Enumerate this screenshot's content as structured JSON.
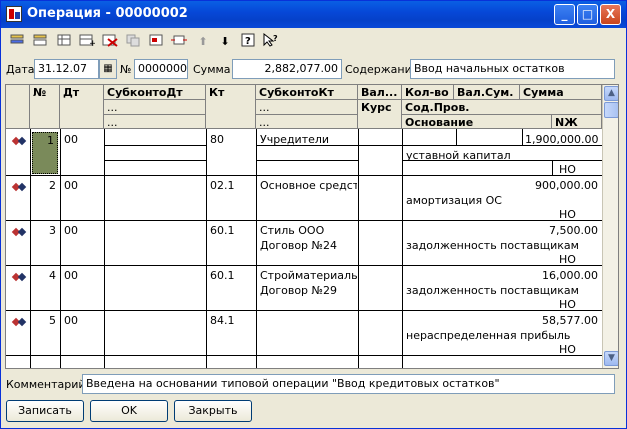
{
  "window": {
    "title": "Операция - 00000002"
  },
  "title_buttons": {
    "minimize": "_",
    "maximize": "□",
    "close": "X"
  },
  "toolbar": {
    "icons": [
      "new-row-icon",
      "copy-row-icon",
      "insert-row-icon",
      "add-sub-row-icon",
      "delete-row-icon",
      "copy-block-icon",
      "edit-row-icon",
      "filter-rows-icon",
      "move-up-icon",
      "move-down-icon",
      "help-icon",
      "whats-this-icon"
    ]
  },
  "form": {
    "date_label": "Дата",
    "date_value": "31.12.07",
    "number_label": "№",
    "number_value": "00000002",
    "sum_label": "Сумма",
    "sum_value": "2,882,077.00",
    "content_label": "Содержание",
    "content_value": "Ввод начальных остатков"
  },
  "grid": {
    "headers": {
      "num": "№",
      "dt": "Дт",
      "subkonto_dt": "СубконтоДт",
      "subkonto_dt_sub1": "...",
      "subkonto_dt_sub2": "...",
      "kt": "Кт",
      "subkonto_kt": "СубконтоКт",
      "subkonto_kt_sub1": "...",
      "subkonto_kt_sub2": "...",
      "val": "Вал...",
      "kurs": "Курс",
      "kol": "Кол-во",
      "valsum": "Вал.Сум.",
      "summa": "Сумма",
      "sod": "Сод.Пров.",
      "osnovanie": "Основание",
      "nzh": "NЖ"
    },
    "rows": [
      {
        "num": "1",
        "dt": "00",
        "kt": "80",
        "subkonto_kt": "Учредители",
        "subkonto_kt2": "",
        "summa": "1,900,000.00",
        "sod": "уставной капитал",
        "nzh": "НО"
      },
      {
        "num": "2",
        "dt": "00",
        "kt": "02.1",
        "subkonto_kt": "Основное средств",
        "subkonto_kt2": "",
        "summa": "900,000.00",
        "sod": "амортизация ОС",
        "nzh": "НО"
      },
      {
        "num": "3",
        "dt": "00",
        "kt": "60.1",
        "subkonto_kt": "Стиль ООО",
        "subkonto_kt2": "Договор №24",
        "summa": "7,500.00",
        "sod": "задолженность поставщикам",
        "nzh": "НО"
      },
      {
        "num": "4",
        "dt": "00",
        "kt": "60.1",
        "subkonto_kt": "Стройматериалы б",
        "subkonto_kt2": "Договор №29",
        "summa": "16,000.00",
        "sod": "задолженность поставщикам",
        "nzh": "НО"
      },
      {
        "num": "5",
        "dt": "00",
        "kt": "84.1",
        "subkonto_kt": "",
        "subkonto_kt2": "",
        "summa": "58,577.00",
        "sod": "нераспределенная прибыль",
        "nzh": "НО"
      }
    ]
  },
  "comment": {
    "label": "Комментарий:",
    "value": "Введена на основании типовой операции \"Ввод кредитовых остатков\""
  },
  "buttons": {
    "save": "Записать",
    "ok": "OK",
    "close": "Закрыть"
  }
}
